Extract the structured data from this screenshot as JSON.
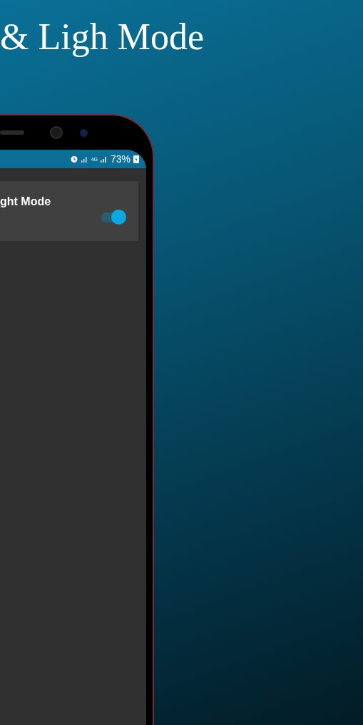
{
  "title": "& Ligh Mode",
  "status_bar": {
    "network": "4G",
    "battery": "73%"
  },
  "settings": [
    {
      "label": "ght Mode",
      "on": true
    }
  ]
}
